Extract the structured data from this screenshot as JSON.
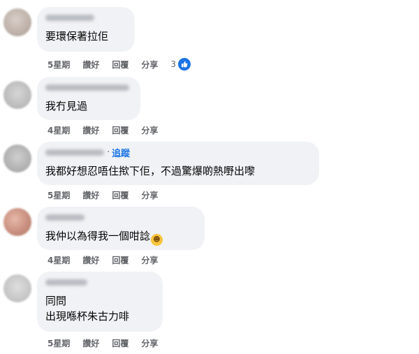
{
  "comments": [
    {
      "text_lines": [
        "要環保著拉佢"
      ],
      "time": "5星期",
      "like_label": "讚好",
      "reply_label": "回覆",
      "share_label": "分享",
      "reaction_count": "3",
      "reaction_icon": "like-icon"
    },
    {
      "text_lines": [
        "我冇見過"
      ],
      "time": "4星期",
      "like_label": "讚好",
      "reply_label": "回覆",
      "share_label": "分享"
    },
    {
      "follow_label": "追蹤",
      "text_lines": [
        "我都好想忍唔住揿下佢，不過驚爆啲熱嘢出嚟"
      ],
      "time": "5星期",
      "like_label": "讚好",
      "reply_label": "回覆",
      "share_label": "分享"
    },
    {
      "text_lines": [
        "我仲以為得我一個咁諗"
      ],
      "emoji": "rolling-on-floor-laughing-emoji",
      "time": "4星期",
      "like_label": "讚好",
      "reply_label": "回覆",
      "share_label": "分享"
    },
    {
      "text_lines": [
        "同問",
        "出現喺杯朱古力啡"
      ],
      "time": "5星期",
      "like_label": "讚好",
      "reply_label": "回覆",
      "share_label": "分享"
    }
  ],
  "colors": {
    "bubble": "#f0f2f5",
    "meta_text": "#65676b",
    "link_blue": "#1b74e4"
  }
}
